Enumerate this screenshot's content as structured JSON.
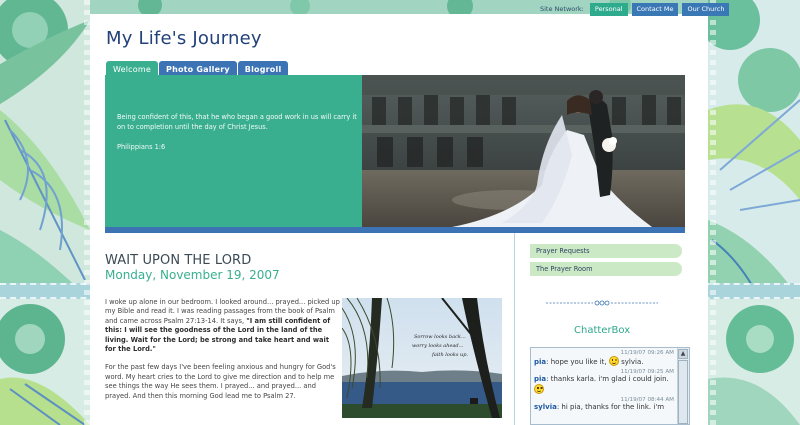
{
  "site": {
    "title": "My Life's Journey"
  },
  "network": {
    "label": "Site Network:",
    "links": [
      "Personal",
      "Contact Me",
      "Our Church"
    ]
  },
  "tabs": [
    {
      "label": "Welcome",
      "active": true
    },
    {
      "label": "Photo Gallery",
      "active": false
    },
    {
      "label": "Blogroll",
      "active": false
    }
  ],
  "banner": {
    "verse": "Being confident of this, that he who began a good work in us will carry it on to completion until the day of Christ Jesus.",
    "reference": "Philippians 1:6"
  },
  "post": {
    "title": "WAIT UPON THE LORD",
    "date": "Monday, November 19, 2007",
    "para1_intro": "I woke up alone in our bedroom. I looked around... prayed... picked up my Bible and read it. I was reading passages from the book of Psalm and came across Psalm 27:13-14. It says, ",
    "para1_quote": "\"I am still confident of this: I will see the goodness of the Lord in the land of the living. Wait for the Lord; be strong and take heart and wait for the Lord.\"",
    "para2": "For the past few days I've been feeling anxious and hungry for God's word. My heart cries to the Lord to give me direction and to help me see things the way He sees them. I prayed... and prayed... and prayed. And then this morning God lead me to Psalm 27.",
    "photo_caption_line1": "Sorrow looks back...",
    "photo_caption_line2": "worry looks ahead...",
    "photo_caption_line3": "faith looks up."
  },
  "sidebar": {
    "links": [
      "Prayer Requests",
      "The Prayer Room"
    ],
    "chatterbox_title": "ChatterBox"
  },
  "chat": [
    {
      "time": "11/19/07 09:26 AM",
      "user": "pia",
      "text": ": hope you like it,",
      "smiley": true,
      "after": " sylvia."
    },
    {
      "time": "11/19/07 09:25 AM",
      "user": "pia",
      "text": ": thanks karla. i'm glad i could join.",
      "smiley": true,
      "after": ""
    },
    {
      "time": "11/19/07 08:44 AM",
      "user": "sylvia",
      "text": ": hi pia, thanks for the link. i'm",
      "smiley": false,
      "after": ""
    }
  ],
  "colors": {
    "accent_green": "#3aaf90",
    "accent_blue": "#3c73b4",
    "title_navy": "#22407a",
    "sidebar_green": "#cbe9c4"
  }
}
